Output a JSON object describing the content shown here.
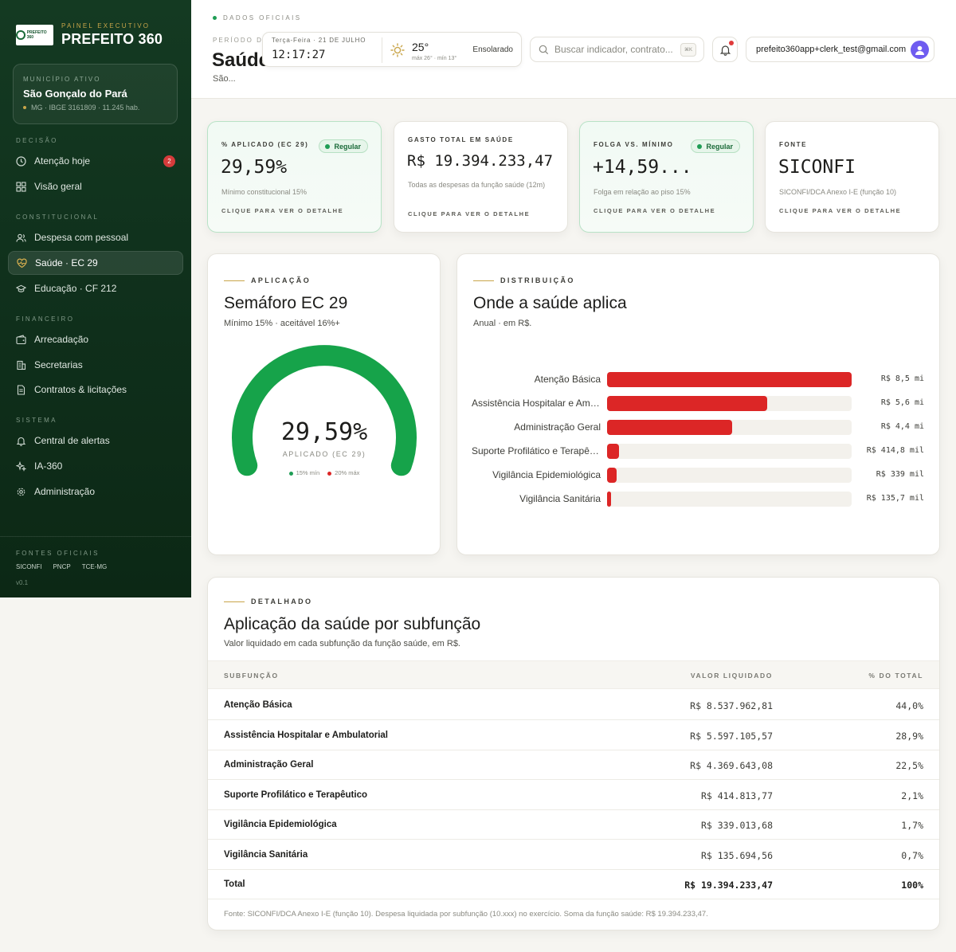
{
  "brand": {
    "kicker": "PAINEL EXECUTIVO",
    "name": "PREFEITO 360",
    "logo_text": "PREFEITO 360"
  },
  "municipio": {
    "kicker": "MUNICÍPIO ATIVO",
    "name": "São Gonçalo do Pará",
    "meta": "MG · IBGE 3161809 · 11.245 hab."
  },
  "nav": {
    "sections": {
      "decisao": "DECISÃO",
      "constitucional": "CONSTITUCIONAL",
      "financeiro": "FINANCEIRO",
      "sistema": "SISTEMA"
    },
    "items": {
      "atencao": {
        "label": "Atenção hoje",
        "badge": "2"
      },
      "visao": {
        "label": "Visão geral"
      },
      "pessoal": {
        "label": "Despesa com pessoal"
      },
      "saude": {
        "label": "Saúde · EC 29"
      },
      "educacao": {
        "label": "Educação · CF 212"
      },
      "arrecadacao": {
        "label": "Arrecadação"
      },
      "secretarias": {
        "label": "Secretarias"
      },
      "contratos": {
        "label": "Contratos & licitações"
      },
      "alertas": {
        "label": "Central de alertas"
      },
      "ia": {
        "label": "IA-360"
      },
      "admin": {
        "label": "Administração"
      }
    },
    "active": "saude"
  },
  "fontes": {
    "kicker": "FONTES OFICIAIS",
    "items": [
      "SICONFI",
      "PNCP",
      "TCE-MG"
    ],
    "version": "v0.1"
  },
  "header": {
    "kicker": "DADOS OFICIAIS",
    "periodo": "PERÍODO DE",
    "title": "Saúde",
    "subtitle": "São...",
    "date_label": "Terça-Feira · 21 DE JULHO",
    "clock": "12:17:27",
    "weather": {
      "temp": "25°",
      "range": "máx 26° · mín 13°",
      "desc": "Ensolarado"
    },
    "search": {
      "placeholder": "Buscar indicador, contrato...",
      "shortcut": "⌘K"
    },
    "user_email": "prefeito360app+clerk_test@gmail.com"
  },
  "kpis": {
    "aplicado": {
      "kicker": "% APLICADO (EC 29)",
      "value": "29,59%",
      "desc": "Mínimo constitucional 15%",
      "link": "CLIQUE PARA VER O DETALHE",
      "status": "Regular"
    },
    "gasto": {
      "kicker": "GASTO TOTAL EM SAÚDE",
      "value": "R$ 19.394.233,47",
      "desc": "Todas as despesas da função saúde (12m)",
      "link": "CLIQUE PARA VER O DETALHE"
    },
    "folga": {
      "kicker": "FOLGA VS. MÍNIMO",
      "value": "+14,59...",
      "desc": "Folga em relação ao piso 15%",
      "link": "CLIQUE PARA VER O DETALHE",
      "status": "Regular"
    },
    "fonte": {
      "kicker": "FONTE",
      "value": "SICONFI",
      "desc": "SICONFI/DCA Anexo I-E (função 10)",
      "link": "CLIQUE PARA VER O DETALHE"
    }
  },
  "semaforo": {
    "kicker": "APLICAÇÃO",
    "title": "Semáforo EC 29",
    "subtitle": "Mínimo 15% · aceitável 16%+",
    "value": "29,59%",
    "value_pct": 29.59,
    "label": "APLICADO (EC 29)",
    "legend_min": "15% mín",
    "legend_max": "20% máx",
    "colors": {
      "good": "#16a34a",
      "min": "#1f9d55",
      "max": "#dc2626"
    }
  },
  "distribuicao": {
    "kicker": "DISTRIBUIÇÃO",
    "title": "Onde a saúde aplica",
    "subtitle": "Anual · em R$."
  },
  "chart_data": {
    "type": "bar",
    "orientation": "horizontal",
    "categories": [
      "Atenção Básica",
      "Assistência Hospitalar e Ambulatorial",
      "Administração Geral",
      "Suporte Profilático e Terapêutico",
      "Vigilância Epidemiológica",
      "Vigilância Sanitária"
    ],
    "values": [
      8537962.81,
      5597105.57,
      4369643.08,
      414813.77,
      339013.68,
      135694.56
    ],
    "display_labels": [
      "Atenção Básica",
      "Assistência Hospitalar e Amb...",
      "Administração Geral",
      "Suporte Profilático e Terapêu...",
      "Vigilância Epidemiológica",
      "Vigilância Sanitária"
    ],
    "value_labels": [
      "R$ 8,5 mi",
      "R$ 5,6 mi",
      "R$ 4,4 mi",
      "R$ 414,8 mil",
      "R$ 339 mil",
      "R$ 135,7 mil"
    ],
    "color": "#dc2626",
    "title": "Onde a saúde aplica",
    "grid": false
  },
  "detalhado": {
    "kicker": "DETALHADO",
    "title": "Aplicação da saúde por subfunção",
    "subtitle": "Valor liquidado em cada subfunção da função saúde, em R$.",
    "columns": {
      "name": "SUBFUNÇÃO",
      "value": "VALOR LIQUIDADO",
      "pct": "% DO TOTAL"
    },
    "rows": [
      {
        "name": "Atenção Básica",
        "value": "R$ 8.537.962,81",
        "pct": "44,0%"
      },
      {
        "name": "Assistência Hospitalar e Ambulatorial",
        "value": "R$ 5.597.105,57",
        "pct": "28,9%"
      },
      {
        "name": "Administração Geral",
        "value": "R$ 4.369.643,08",
        "pct": "22,5%"
      },
      {
        "name": "Suporte Profilático e Terapêutico",
        "value": "R$ 414.813,77",
        "pct": "2,1%"
      },
      {
        "name": "Vigilância Epidemiológica",
        "value": "R$ 339.013,68",
        "pct": "1,7%"
      },
      {
        "name": "Vigilância Sanitária",
        "value": "R$ 135.694,56",
        "pct": "0,7%"
      }
    ],
    "total": {
      "name": "Total",
      "value": "R$ 19.394.233,47",
      "pct": "100%"
    },
    "footnote": "Fonte: SICONFI/DCA Anexo I-E (função 10). Despesa liquidada por subfunção (10.xxx) no exercício. Soma da função saúde: R$ 19.394.233,47."
  }
}
